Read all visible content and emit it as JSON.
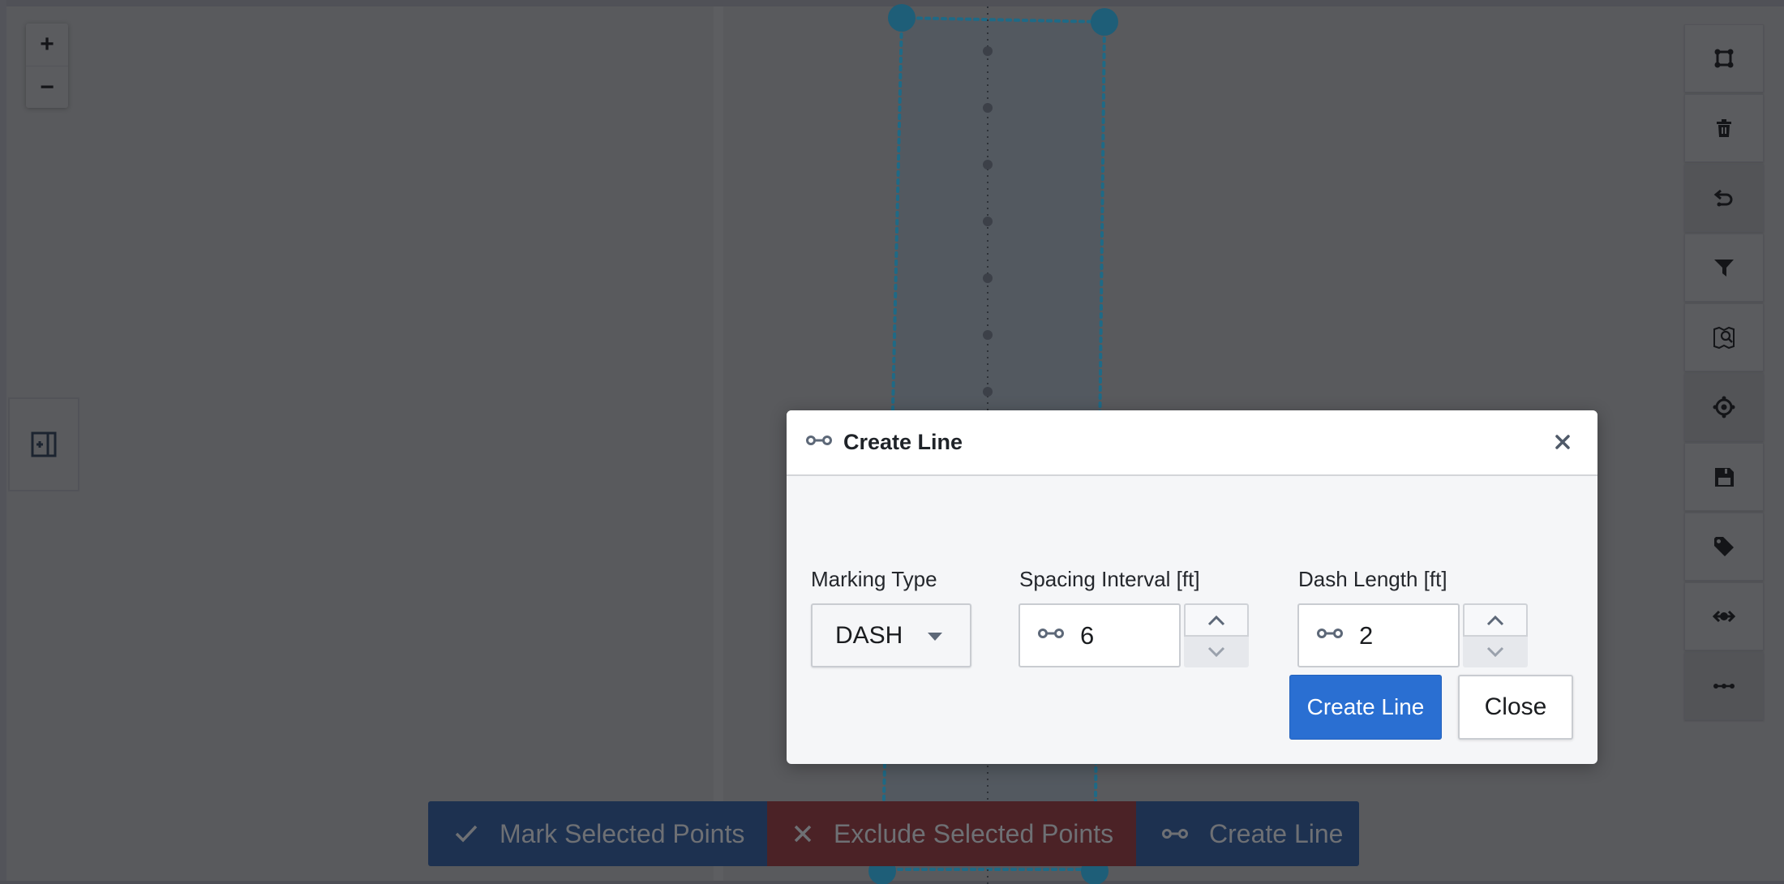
{
  "map": {
    "zoom_in_label": "+",
    "zoom_out_label": "−",
    "left_panel_toggle_icon": "panel-expand-icon"
  },
  "toolbar": {
    "buttons": [
      {
        "icon": "polygon-select-icon",
        "active": false
      },
      {
        "icon": "trash-icon",
        "active": false
      },
      {
        "icon": "undo-icon",
        "active": true
      },
      {
        "icon": "filter-icon",
        "active": false
      },
      {
        "icon": "map-search-icon",
        "active": false
      },
      {
        "icon": "crosshair-icon",
        "active": true
      },
      {
        "icon": "save-icon",
        "active": false
      },
      {
        "icon": "tag-icon",
        "active": false
      },
      {
        "icon": "move-horizontal-icon",
        "active": false
      },
      {
        "icon": "dotted-line-icon",
        "active": true
      }
    ]
  },
  "action_bar": {
    "mark_label": "Mark Selected Points",
    "exclude_label": "Exclude Selected Points",
    "create_line_label": "Create Line",
    "colors": {
      "mark": "#1d3150",
      "exclude": "#4b2226",
      "create": "#1d3150"
    }
  },
  "modal": {
    "title": "Create Line",
    "title_icon": "line-segment-icon",
    "fields": {
      "marking_type": {
        "label": "Marking Type",
        "value": "DASH"
      },
      "spacing_interval": {
        "label": "Spacing Interval [ft]",
        "value": "6"
      },
      "dash_length": {
        "label": "Dash Length [ft]",
        "value": "2"
      }
    },
    "primary_button": "Create Line",
    "secondary_button": "Close",
    "accent_color": "#2a6fd2"
  }
}
